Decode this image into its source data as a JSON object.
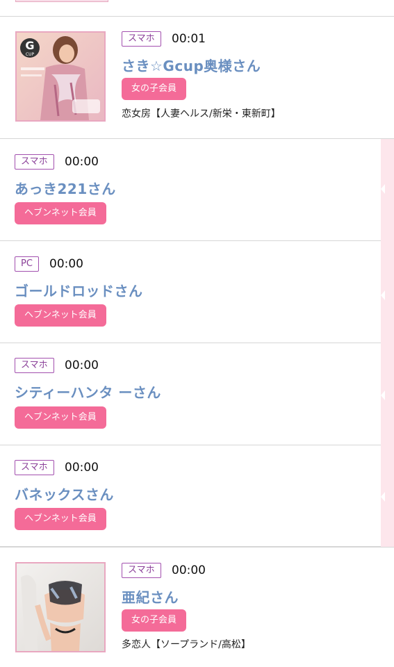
{
  "rows": [
    {
      "device": "スマホ",
      "time": "00:01",
      "name": "さき☆Gcup奥様さん",
      "member": "女の子会員",
      "shop": "恋女房【人妻ヘルス/新栄・東新町】",
      "thumb_badge": "G",
      "thumb_badge_sub": "CUP"
    },
    {
      "device": "スマホ",
      "time": "00:00",
      "name": "あっき221さん",
      "member": "ヘブンネット会員"
    },
    {
      "device": "PC",
      "time": "00:00",
      "name": "ゴールドロッドさん",
      "member": "ヘブンネット会員"
    },
    {
      "device": "スマホ",
      "time": "00:00",
      "name": "シティーハンタ ーさん",
      "member": "ヘブンネット会員"
    },
    {
      "device": "スマホ",
      "time": "00:00",
      "name": "バネックスさん",
      "member": "ヘブンネット会員"
    },
    {
      "device": "スマホ",
      "time": "00:00",
      "name": "亜紀さん",
      "member": "女の子会員",
      "shop": "多恋人【ソープランド/高松】"
    }
  ],
  "colors": {
    "device_border": "#a24fae",
    "name_link": "#6a8fc0",
    "member_badge": "#f46b98",
    "thumb_border": "#e9a7c0",
    "side_rail": "#fde6ec"
  }
}
